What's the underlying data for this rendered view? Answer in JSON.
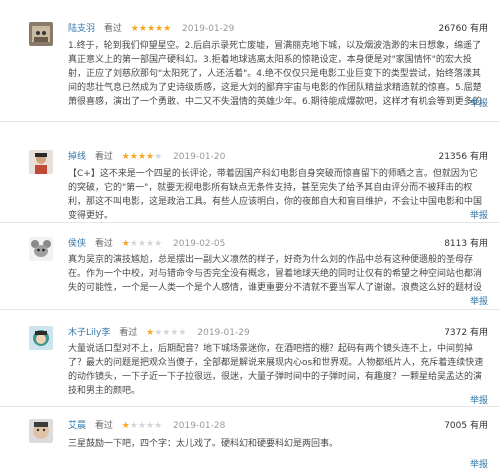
{
  "colors": {
    "link": "#3377aa",
    "star": "#f5a623",
    "text": "#494949",
    "muted": "#999999"
  },
  "reviews": [
    {
      "user": "陆支羽",
      "status": "看过",
      "rating": 5,
      "date": "2019-01-29",
      "votes": "26760",
      "vote_label": "有用",
      "text": "1.终于，轮到我们仰望星空。2.后启示录死亡废墟，冒满丽克地下城，以及烟波浩渺的末日想象，绵遥了真正意义上的第一部国产硬科幻。3.拒着地球逃离太阳系的惊艳设定，本身便是对\"家国情怀\"的宏大投射，正应了刘慈欣那句\"太阳死了，人还活着\"。4.绝不仅仅只是电影工业巨变下的类型尝试，始终落漾其间的悲壮气息已然成为了史诗级质感，这是大刘的鄙弃宇宙与电影的作团队精益求精造就的惊喜。5.屈楚萧很喜感，演出了一个勇敢、中二又不失温情的英雄少年。6.期待能成爆款吧，这样才有机会等到更多的国产科幻电影；或许以后会出现更好的，但至今这无疑是最好的。",
      "report": "举报",
      "avatar_icon": "cat-avatar-icon"
    },
    {
      "user": "掉线",
      "status": "看过",
      "rating": 4,
      "date": "2019-01-20",
      "votes": "21356",
      "vote_label": "有用",
      "text": "【C+】这不来是一个四星的长评论，带着因国产科幻电影自身突破而惊喜留下的师晒之言。但就因为它的突破，它的\"第一\"，就要无视电影所有缺点无条件支持，甚至完失了给予其自由评分而不被拜击的权利，那这不叫电影，这是政治工具。有些人应该明白，你的夜郎自大和盲目维护，不会让中国电影和中国变得更好。",
      "report": "举报",
      "avatar_icon": "person-avatar-icon"
    },
    {
      "user": "侯侠",
      "status": "看过",
      "rating": 1,
      "date": "2019-02-05",
      "votes": "8113",
      "vote_label": "有用",
      "text": "真为吴京的演技尴尬，总是摆出一副大义凛然的样子，好奇为什么刘的作品中总有这种便遗般的圣母存在。作为一个中校，对与错命令与否完全没有概念，冒着地球天绝的同时让仅有的希望之种空间站也都消失的可能性，一个是一人类一个是个人感情，谁更重要分不清就不要当军人了谢谢。浪费这么好的题材设定，吐",
      "report": "举报",
      "avatar_icon": "mouse-avatar-icon"
    },
    {
      "user": "木子Lily李",
      "status": "看过",
      "rating": 1,
      "date": "2019-01-29",
      "votes": "7372",
      "vote_label": "有用",
      "text": "大量说话口型对不上，后期配音？地下城场景迷你，在酒吧搭的棚？起码有两个镜头连不上，中间剪掉了？最大的问题是把观众当傻子，全部都是解说来展现内心os和世界观。人物都纸片人，充斥着连续快速的动作镜头，一下子近一下子拉很远，很迷，大量子弹时间中的子弹时间，有趣度？一颗星给吴孟达的演技和男主的颜吧。",
      "report": "举报",
      "avatar_icon": "girl-avatar-icon"
    },
    {
      "user": "艾晨",
      "status": "看过",
      "rating": 1,
      "date": "2019-01-28",
      "votes": "7005",
      "vote_label": "有用",
      "text": "三星鼓励一下吧，四个字：太儿戏了。硬科幻和硬要科幻是两回事。",
      "report": "举报",
      "avatar_icon": "face-avatar-icon"
    }
  ]
}
